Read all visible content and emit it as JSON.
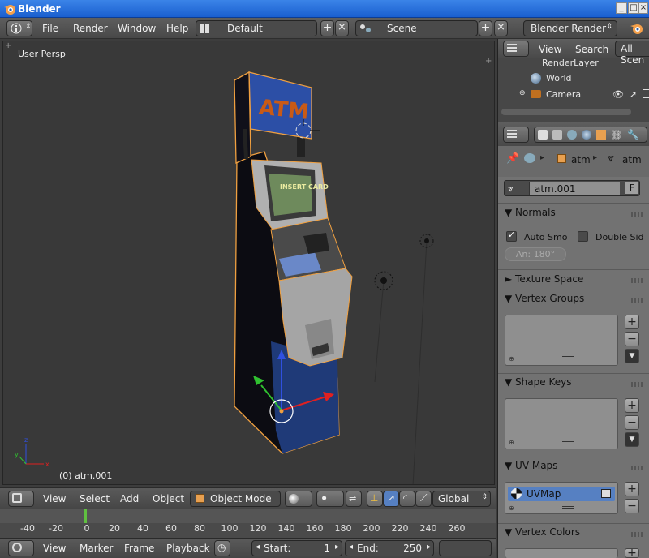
{
  "window": {
    "title": "Blender"
  },
  "menu": {
    "file": "File",
    "render": "Render",
    "window": "Window",
    "help": "Help"
  },
  "layout": {
    "name": "Default"
  },
  "scene": {
    "name": "Scene"
  },
  "engine": {
    "name": "Blender Render"
  },
  "viewport": {
    "view_label": "User Persp",
    "object_label": "(0) atm.001",
    "sign_text": "ATM",
    "screen_text": "INSERT CARD"
  },
  "viewport_header": {
    "view": "View",
    "select": "Select",
    "add": "Add",
    "object": "Object",
    "mode": "Object Mode",
    "orientation": "Global"
  },
  "timeline": {
    "ticks": [
      "-40",
      "-20",
      "0",
      "20",
      "40",
      "60",
      "80",
      "100",
      "120",
      "140",
      "160",
      "180",
      "200",
      "220",
      "240",
      "260"
    ],
    "view": "View",
    "marker": "Marker",
    "frame": "Frame",
    "playback": "Playback",
    "start_label": "Start:",
    "start_value": "1",
    "end_label": "End:",
    "end_value": "250"
  },
  "outliner": {
    "view": "View",
    "search": "Search",
    "filter": "All Scen",
    "items": [
      "RenderLayer",
      "World",
      "Camera"
    ]
  },
  "properties": {
    "breadcrumb_object": "atm",
    "breadcrumb_mesh": "atm",
    "mesh_name": "atm.001",
    "fake_user": "F",
    "normals_title": "Normals",
    "auto_smooth": "Auto Smo",
    "double_sided": "Double Sid",
    "angle": "An: 180°",
    "texture_space": "Texture Space",
    "vertex_groups": "Vertex Groups",
    "shape_keys": "Shape Keys",
    "uv_maps": "UV Maps",
    "uv_map_name": "UVMap",
    "vertex_colors": "Vertex Colors"
  },
  "colors": {
    "accent": "#5680c2",
    "object_outline": "#f0a040",
    "titlebar": "#2a6fdb"
  }
}
